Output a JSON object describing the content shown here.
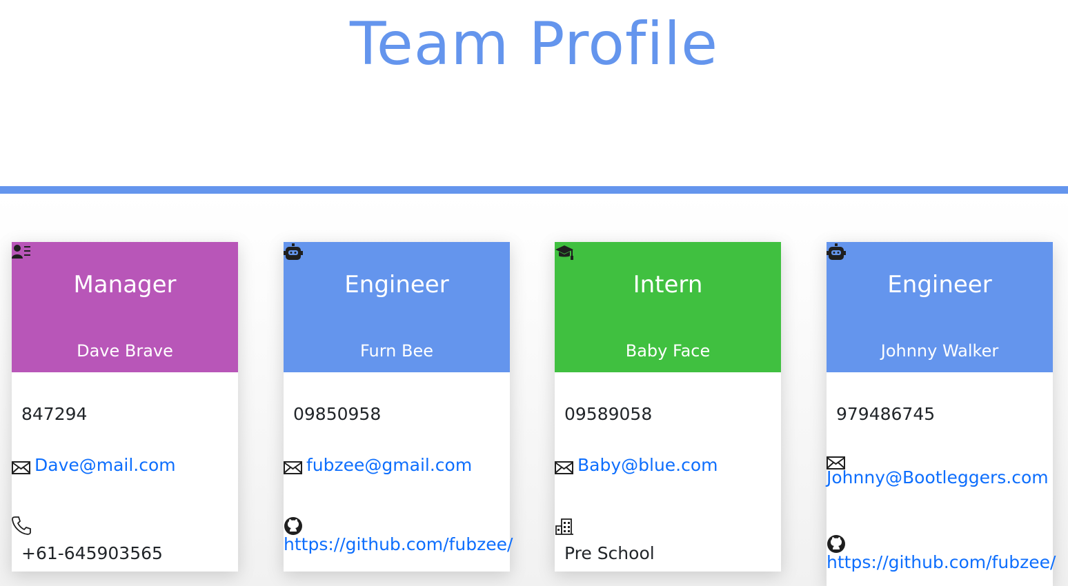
{
  "page_title": "Team Profile",
  "colors": {
    "accent": "#6495ed",
    "manager": "#b856b8",
    "engineer": "#6495ed",
    "intern": "#40c040",
    "link": "#0d6efd"
  },
  "cards": [
    {
      "role": "Manager",
      "role_icon": "id-card-icon",
      "name": "Dave Brave",
      "id": "847294",
      "email": "Dave@mail.com",
      "extra_icon": "phone-icon",
      "extra": "+61-645903565"
    },
    {
      "role": "Engineer",
      "role_icon": "robot-icon",
      "name": "Furn Bee",
      "id": "09850958",
      "email": "fubzee@gmail.com",
      "extra_icon": "github-icon",
      "extra": "https://github.com/fubzee/"
    },
    {
      "role": "Intern",
      "role_icon": "graduation-cap-icon",
      "name": "Baby Face",
      "id": "09589058",
      "email": "Baby@blue.com",
      "extra_icon": "building-icon",
      "extra": "Pre School"
    },
    {
      "role": "Engineer",
      "role_icon": "robot-icon",
      "name": "Johnny Walker",
      "id": "979486745",
      "email": "Johnny@Bootleggers.com",
      "extra_icon": "github-icon",
      "extra": "https://github.com/fubzee/"
    }
  ]
}
